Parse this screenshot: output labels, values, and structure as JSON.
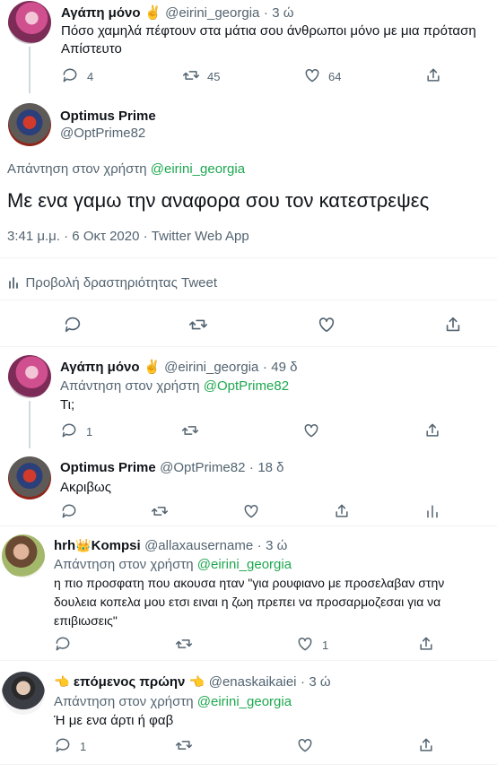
{
  "tweet1": {
    "name": "Αγάπη μόνο",
    "emoji": "✌",
    "handle": "@eirini_georgia",
    "time": "3 ώ",
    "text_line1": "Πόσο χαμηλά πέφτουν στα μάτια σου άνθρωποι μόνο με μια πρόταση",
    "text_line2": "Απίστευτο",
    "replies": "4",
    "retweets": "45",
    "likes": "64"
  },
  "main": {
    "name": "Optimus Prime",
    "handle": "@OptPrime82",
    "reply_prefix": "Απάντηση στον χρήστη",
    "reply_to": "@eirini_georgia",
    "text": "Με ενα γαμω την αναφορα σου τον κατεστρεψες",
    "meta": "3:41 μ.μ. · 6 Οκτ 2020 · Twitter Web App",
    "activity": "Προβολή δραστηριότητας Tweet"
  },
  "reply1": {
    "name": "Αγάπη μόνο",
    "emoji": "✌",
    "handle": "@eirini_georgia",
    "time": "49 δ",
    "reply_prefix": "Απάντηση στον χρήστη",
    "reply_to": "@OptPrime82",
    "text": "Τι;",
    "replies": "1"
  },
  "reply2": {
    "name": "Optimus Prime",
    "handle": "@OptPrime82",
    "time": "18 δ",
    "text": "Ακριβως"
  },
  "reply3": {
    "name_a": "hrh",
    "emoji": "👑",
    "name_b": "Kompsi",
    "handle": "@allaxausername",
    "time": "3 ώ",
    "reply_prefix": "Απάντηση στον χρήστη",
    "reply_to": "@eirini_georgia",
    "text_line1": "η πιο προσφατη που ακουσα ηταν \"για ρουφιανο με προσελαβαν στην",
    "text_line2": "δουλεια κοπελα μου ετσι ειναι η ζωη πρεπει να προσαρμοζεσαι για να",
    "text_line3": "επιβιωσεις\"",
    "likes": "1"
  },
  "reply4": {
    "emoji_left": "👈",
    "name": "επόμενος πρώην",
    "emoji_right": "👈",
    "handle": "@enaskaikaiei",
    "time": "3 ώ",
    "reply_prefix": "Απάντηση στον χρήστη",
    "reply_to": "@eirini_georgia",
    "text": "Ή με ενα άρτι ή φαβ",
    "replies": "1"
  }
}
